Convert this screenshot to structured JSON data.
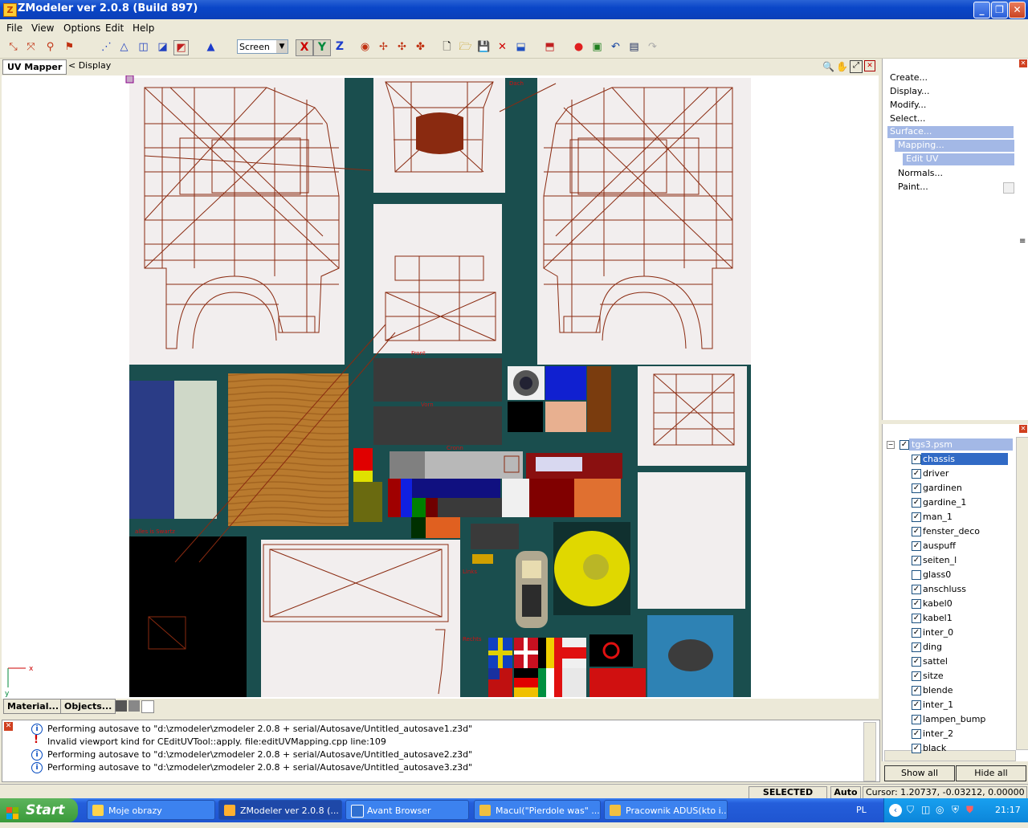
{
  "window": {
    "title": "ZModeler ver 2.0.8 (Build 897)",
    "app_icon": "Z"
  },
  "menubar": [
    "File",
    "View",
    "Options",
    "Edit",
    "Help"
  ],
  "toolbar": {
    "coord_system": "Screen",
    "axes": [
      {
        "label": "X",
        "color": "#cc0000"
      },
      {
        "label": "Y",
        "color": "#00883a"
      },
      {
        "label": "Z",
        "color": "#1c3ccc"
      }
    ]
  },
  "uv_panel": {
    "tab_label": "UV Mapper",
    "display_label": "< Display"
  },
  "viewport_axes": {
    "x": "x",
    "y": "y"
  },
  "bottom_buttons": {
    "material": "Material...",
    "objects": "Objects..."
  },
  "log": [
    {
      "type": "info",
      "text": "Performing autosave to \"d:\\zmodeler\\zmodeler 2.0.8 + serial/Autosave/Untitled_autosave1.z3d\""
    },
    {
      "type": "warning",
      "text": "Invalid viewport kind for CEditUVTool::apply.  file:editUVMapping.cpp line:109"
    },
    {
      "type": "info",
      "text": "Performing autosave to \"d:\\zmodeler\\zmodeler 2.0.8 + serial/Autosave/Untitled_autosave2.z3d\""
    },
    {
      "type": "info",
      "text": "Performing autosave to \"d:\\zmodeler\\zmodeler 2.0.8 + serial/Autosave/Untitled_autosave3.z3d\""
    }
  ],
  "command_menu": [
    {
      "label": "Create...",
      "level": 0,
      "selected": false
    },
    {
      "label": "Display...",
      "level": 0,
      "selected": false
    },
    {
      "label": "Modify...",
      "level": 0,
      "selected": false
    },
    {
      "label": "Select...",
      "level": 0,
      "selected": false
    },
    {
      "label": "Surface...",
      "level": 0,
      "selected": true
    },
    {
      "label": "Mapping...",
      "level": 1,
      "selected": true
    },
    {
      "label": "Edit UV",
      "level": 2,
      "selected": true
    },
    {
      "label": "Normals...",
      "level": 1,
      "selected": false
    },
    {
      "label": "Paint...",
      "level": 1,
      "selected": false
    }
  ],
  "scene_tree": {
    "root": "tgs3.psm",
    "items": [
      {
        "label": "chassis",
        "checked": true,
        "selected": true
      },
      {
        "label": "driver",
        "checked": true
      },
      {
        "label": "gardinen",
        "checked": true
      },
      {
        "label": "gardine_1",
        "checked": true
      },
      {
        "label": "man_1",
        "checked": true
      },
      {
        "label": "fenster_deco",
        "checked": true
      },
      {
        "label": "auspuff",
        "checked": true
      },
      {
        "label": "seiten_l",
        "checked": true
      },
      {
        "label": "glass0",
        "checked": false
      },
      {
        "label": "anschluss",
        "checked": true
      },
      {
        "label": "kabel0",
        "checked": true
      },
      {
        "label": "kabel1",
        "checked": true
      },
      {
        "label": "inter_0",
        "checked": true
      },
      {
        "label": "ding",
        "checked": true
      },
      {
        "label": "sattel",
        "checked": true
      },
      {
        "label": "sitze",
        "checked": true
      },
      {
        "label": "blende",
        "checked": true
      },
      {
        "label": "inter_1",
        "checked": true
      },
      {
        "label": "lampen_bump",
        "checked": true
      },
      {
        "label": "inter_2",
        "checked": true
      },
      {
        "label": "black",
        "checked": true
      }
    ],
    "show_all": "Show all",
    "hide_all": "Hide all"
  },
  "texture_labels": [
    "Dach",
    "alles is Swartz",
    "Links",
    "Rechts",
    "Front",
    "Vorn",
    "Cronn"
  ],
  "statusbar": {
    "mode": "SELECTED MODE",
    "auto": "Auto",
    "cursor": "Cursor: 1.20737, -0.03212, 0.00000"
  },
  "taskbar": {
    "start": "Start",
    "tasks": [
      "Moje obrazy",
      "ZModeler ver 2.0.8 (...",
      "Avant Browser",
      "Macul(\"Pierdole was\" ...",
      "Pracownik ADUS(kto i..."
    ],
    "lang": "PL",
    "clock": "21:17"
  }
}
